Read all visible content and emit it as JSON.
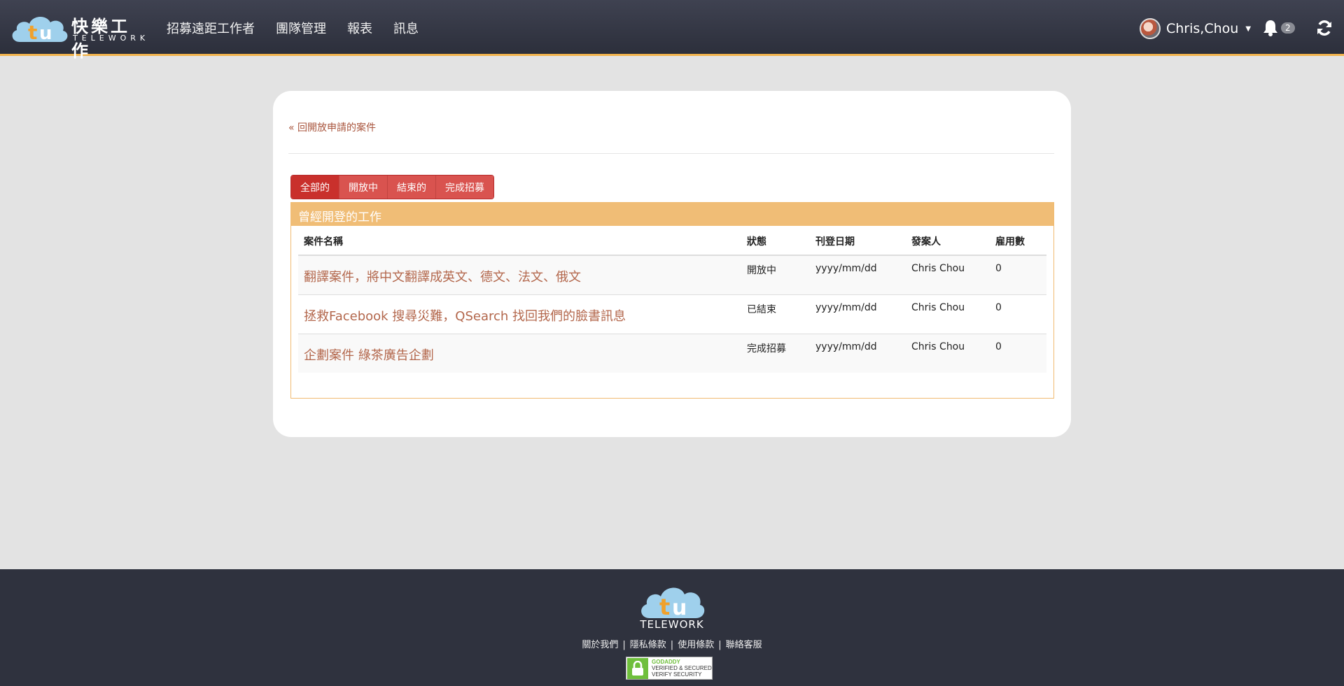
{
  "header": {
    "brand_cn": "快樂工作",
    "brand_en": "TELEWORK",
    "nav": [
      "招募遠距工作者",
      "團隊管理",
      "報表",
      "訊息"
    ],
    "user_name": "Chris,Chou",
    "notification_count": "2"
  },
  "main": {
    "back_link": "« 回開放申請的案件",
    "filters": [
      {
        "label": "全部的",
        "active": true
      },
      {
        "label": "開放中",
        "active": false
      },
      {
        "label": "結束的",
        "active": false
      },
      {
        "label": "完成招募",
        "active": false
      }
    ],
    "panel_title": "曾經開登的工作",
    "columns": [
      "案件名稱",
      "狀態",
      "刊登日期",
      "發案人",
      "雇用數"
    ],
    "rows": [
      {
        "title": "翻譯案件，將中文翻譯成英文、德文、法文、俄文",
        "status": "開放中",
        "date": "yyyy/mm/dd",
        "poster": "Chris Chou",
        "hires": "0"
      },
      {
        "title": "拯救Facebook 搜尋災難，QSearch 找回我們的臉書訊息",
        "status": "已結束",
        "date": "yyyy/mm/dd",
        "poster": "Chris Chou",
        "hires": "0"
      },
      {
        "title": "企劃案件 綠茶廣告企劃",
        "status": "完成招募",
        "date": "yyyy/mm/dd",
        "poster": "Chris Chou",
        "hires": "0"
      }
    ]
  },
  "footer": {
    "brand": "TELEWORK",
    "links": [
      "關於我們",
      "隱私條款",
      "使用條款",
      "聯絡客服"
    ],
    "seal": {
      "line1": "GODADDY",
      "line2": "VERIFIED & SECURED",
      "line3": "VERIFY SECURITY"
    }
  },
  "colors": {
    "navbar": "#33363f",
    "accent": "#f0b24c",
    "button": "#d9534f",
    "link": "#b3674c",
    "footer": "#2f323e"
  },
  "icons": [
    "cloud-logo-icon",
    "caret-down-icon",
    "bell-icon",
    "refresh-icon",
    "lock-icon"
  ]
}
